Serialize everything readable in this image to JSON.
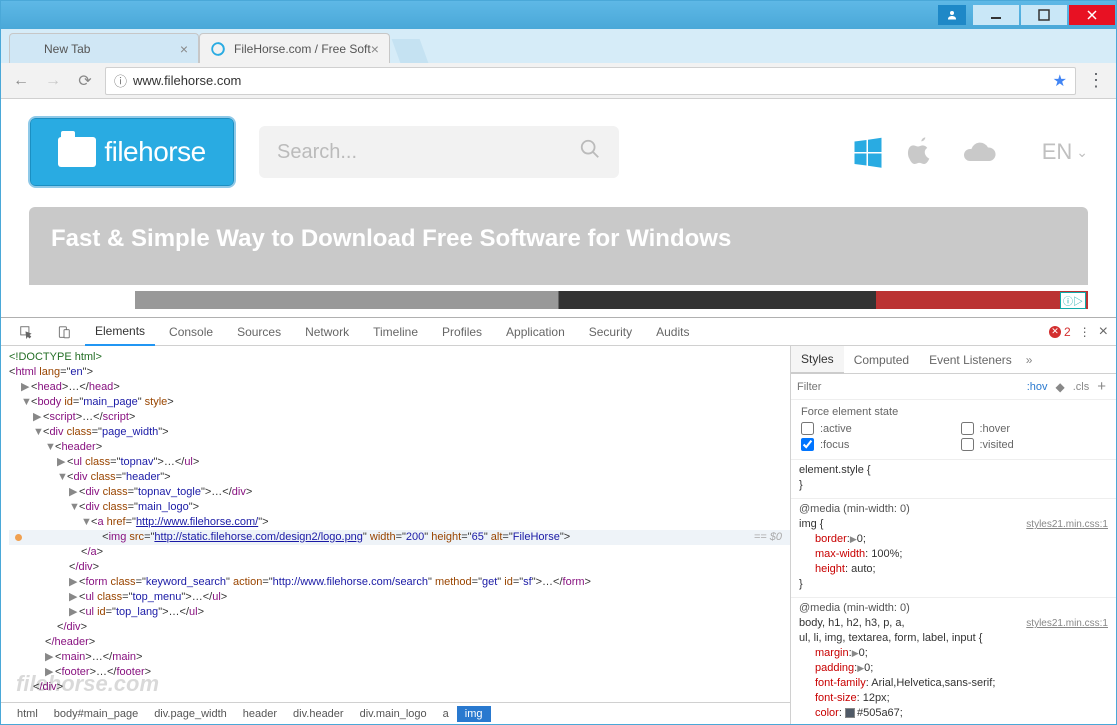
{
  "window": {
    "tabs": [
      {
        "title": "New Tab",
        "active": false
      },
      {
        "title": "FileHorse.com / Free Soft",
        "active": true
      }
    ],
    "url": "www.filehorse.com",
    "error_count": "2"
  },
  "page": {
    "logo_text": "filehorse",
    "logo_alt": "FileHorse",
    "search_placeholder": "Search...",
    "lang": "EN",
    "banner_text": "Fast & Simple Way to Download Free Software for Windows"
  },
  "devtools": {
    "tabs": [
      "Elements",
      "Console",
      "Sources",
      "Network",
      "Timeline",
      "Profiles",
      "Application",
      "Security",
      "Audits"
    ],
    "active_tab": "Elements",
    "breadcrumb": [
      "html",
      "body#main_page",
      "div.page_width",
      "header",
      "div.header",
      "div.main_logo",
      "a",
      "img"
    ],
    "breadcrumb_selected": "img",
    "dom": {
      "l0": "<!DOCTYPE html>",
      "l1_open": "html",
      "l1_attrs": "lang=\"en\"",
      "l2": "head",
      "l3_open": "body",
      "l3_attrs_name": "id",
      "l3_attrs_val": "main_page",
      "l3_style": "style",
      "l4": "script",
      "l5_open": "div",
      "l5_an": "class",
      "l5_av": "page_width",
      "l6": "header",
      "l7_open": "ul",
      "l7_an": "class",
      "l7_av": "topnav",
      "l8_open": "div",
      "l8_an": "class",
      "l8_av": "header",
      "l9_open": "div",
      "l9_an": "class",
      "l9_av": "topnav_togle",
      "l10_open": "div",
      "l10_an": "class",
      "l10_av": "main_logo",
      "l11_open": "a",
      "l11_an": "href",
      "l11_av": "http://www.filehorse.com/",
      "l12_open": "img",
      "l12_src": "http://static.filehorse.com/design2/logo.png",
      "l12_w": "200",
      "l12_h": "65",
      "l12_alt": "FileHorse",
      "l12_eq": "== $0",
      "l13": "/a",
      "l14": "/div",
      "l15_open": "form",
      "l15_a1n": "class",
      "l15_a1v": "keyword_search",
      "l15_a2n": "action",
      "l15_a2v": "http://www.filehorse.com/search",
      "l15_a3n": "method",
      "l15_a3v": "get",
      "l15_a4n": "id",
      "l15_a4v": "sf",
      "l16_open": "ul",
      "l16_an": "class",
      "l16_av": "top_menu",
      "l17_open": "ul",
      "l17_an": "id",
      "l17_av": "top_lang",
      "l18": "/div",
      "l19": "/header",
      "l20": "main",
      "l21": "footer",
      "l22": "/div"
    },
    "styles": {
      "tabs": [
        "Styles",
        "Computed",
        "Event Listeners"
      ],
      "filter_placeholder": "Filter",
      "hov": ":hov",
      "cls": ".cls",
      "force_title": "Force element state",
      "pseudo": {
        "active": ":active",
        "hover": ":hover",
        "focus": ":focus",
        "visited": ":visited"
      },
      "rule1_sel": "element.style {",
      "media": "@media (min-width: 0)",
      "src": "styles21.min.css:1",
      "rule2_sel": "img {",
      "rule2_p1": "border",
      "rule2_v1": "0",
      "rule2_p2": "max-width",
      "rule2_v2": "100%",
      "rule2_p3": "height",
      "rule2_v3": "auto",
      "rule3_sel": "body, h1, h2, h3, p, a,",
      "rule3_sel2": "ul, li, img, textarea, form, label, input {",
      "rule3_p1": "margin",
      "rule3_v1": "0",
      "rule3_p2": "padding",
      "rule3_v2": "0",
      "rule3_p3": "font-family",
      "rule3_v3": "Arial,Helvetica,sans-serif",
      "rule3_p4": "font-size",
      "rule3_v4": "12px",
      "rule3_p5": "color",
      "rule3_v5": "#505a67"
    }
  },
  "watermark": "filehorse.com"
}
